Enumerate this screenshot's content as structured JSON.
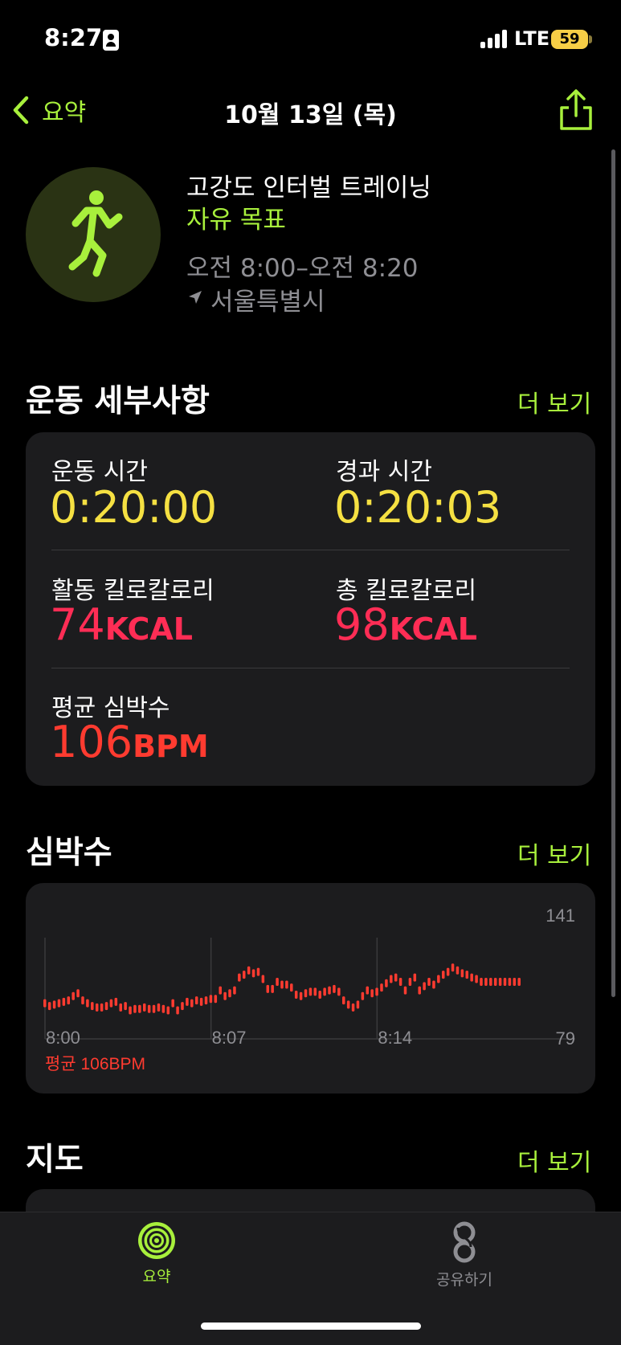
{
  "status_bar": {
    "time": "8:27",
    "network": "LTE",
    "battery": "59"
  },
  "nav": {
    "back_label": "요약",
    "title": "10월 13일 (목)"
  },
  "workout": {
    "name": "고강도 인터벌 트레이닝",
    "goal": "자유 목표",
    "time_range": "오전 8:00–오전 8:20",
    "location": "서울특별시"
  },
  "details": {
    "title": "운동 세부사항",
    "more": "더 보기",
    "workout_time_label": "운동 시간",
    "workout_time_value": "0:20:00",
    "elapsed_time_label": "경과 시간",
    "elapsed_time_value": "0:20:03",
    "active_kcal_label": "활동 킬로칼로리",
    "active_kcal_value": "74",
    "active_kcal_unit": "KCAL",
    "total_kcal_label": "총 킬로칼로리",
    "total_kcal_value": "98",
    "total_kcal_unit": "KCAL",
    "avg_hr_label": "평균 심박수",
    "avg_hr_value": "106",
    "avg_hr_unit": "BPM"
  },
  "heart_rate": {
    "title": "심박수",
    "more": "더 보기",
    "average_label": "평균 106BPM"
  },
  "map": {
    "title": "지도",
    "more": "더 보기"
  },
  "tab_bar": {
    "summary_label": "요약",
    "share_label": "공유하기"
  },
  "colors": {
    "accent": "#a8f03c",
    "yellow": "#f5e042",
    "pink": "#ff2d55",
    "hr_red": "#ff3b30"
  },
  "chart_data": {
    "type": "scatter",
    "x_tick_labels": [
      "8:00",
      "8:07",
      "8:14"
    ],
    "y_max_label": "141",
    "y_min_label": "79",
    "ylim": [
      79,
      141
    ],
    "x_unit": "minutes",
    "series": [
      {
        "x": [
          0.0,
          0.2,
          0.4,
          0.6,
          0.8,
          1.0,
          1.2,
          1.4,
          1.6,
          1.8,
          2.0,
          2.2,
          2.4,
          2.6,
          2.8,
          3.0,
          3.2,
          3.4,
          3.6,
          3.8,
          4.0,
          4.2,
          4.4,
          4.6,
          4.8,
          5.0,
          5.2,
          5.4,
          5.6,
          5.8,
          6.0,
          6.2,
          6.4,
          6.6,
          6.8,
          7.0,
          7.2,
          7.4,
          7.6,
          7.8,
          8.0,
          8.2,
          8.4,
          8.6,
          8.8,
          9.0,
          9.2,
          9.4,
          9.6,
          9.8,
          10.0,
          10.2,
          10.4,
          10.6,
          10.8,
          11.0,
          11.2,
          11.4,
          11.6,
          11.8,
          12.0,
          12.2,
          12.4,
          12.6,
          12.8,
          13.0,
          13.2,
          13.4,
          13.6,
          13.8,
          14.0,
          14.2,
          14.4,
          14.6,
          14.8,
          15.0,
          15.2,
          15.4,
          15.6,
          15.8,
          16.0,
          16.2,
          16.4,
          16.6,
          16.8,
          17.0,
          17.2,
          17.4,
          17.6,
          17.8,
          18.0,
          18.2,
          18.4,
          18.6,
          18.8,
          19.0,
          19.2,
          19.4,
          19.6,
          19.8,
          20.0
        ],
        "y": [
          95,
          93,
          94,
          95,
          96,
          97,
          100,
          102,
          97,
          95,
          93,
          92,
          92,
          93,
          95,
          96,
          92,
          93,
          90,
          91,
          91,
          92,
          91,
          91,
          92,
          91,
          90,
          95,
          90,
          93,
          96,
          95,
          97,
          96,
          97,
          98,
          98,
          104,
          100,
          102,
          104,
          113,
          115,
          118,
          116,
          117,
          112,
          105,
          105,
          110,
          108,
          108,
          106,
          101,
          100,
          102,
          103,
          103,
          101,
          103,
          104,
          105,
          103,
          97,
          94,
          92,
          94,
          100,
          104,
          102,
          103,
          106,
          109,
          112,
          113,
          110,
          104,
          110,
          113,
          104,
          107,
          110,
          108,
          112,
          115,
          117,
          120,
          118,
          116,
          115,
          113,
          112,
          110,
          110,
          110,
          110,
          110,
          110,
          110,
          110,
          110
        ]
      }
    ]
  }
}
